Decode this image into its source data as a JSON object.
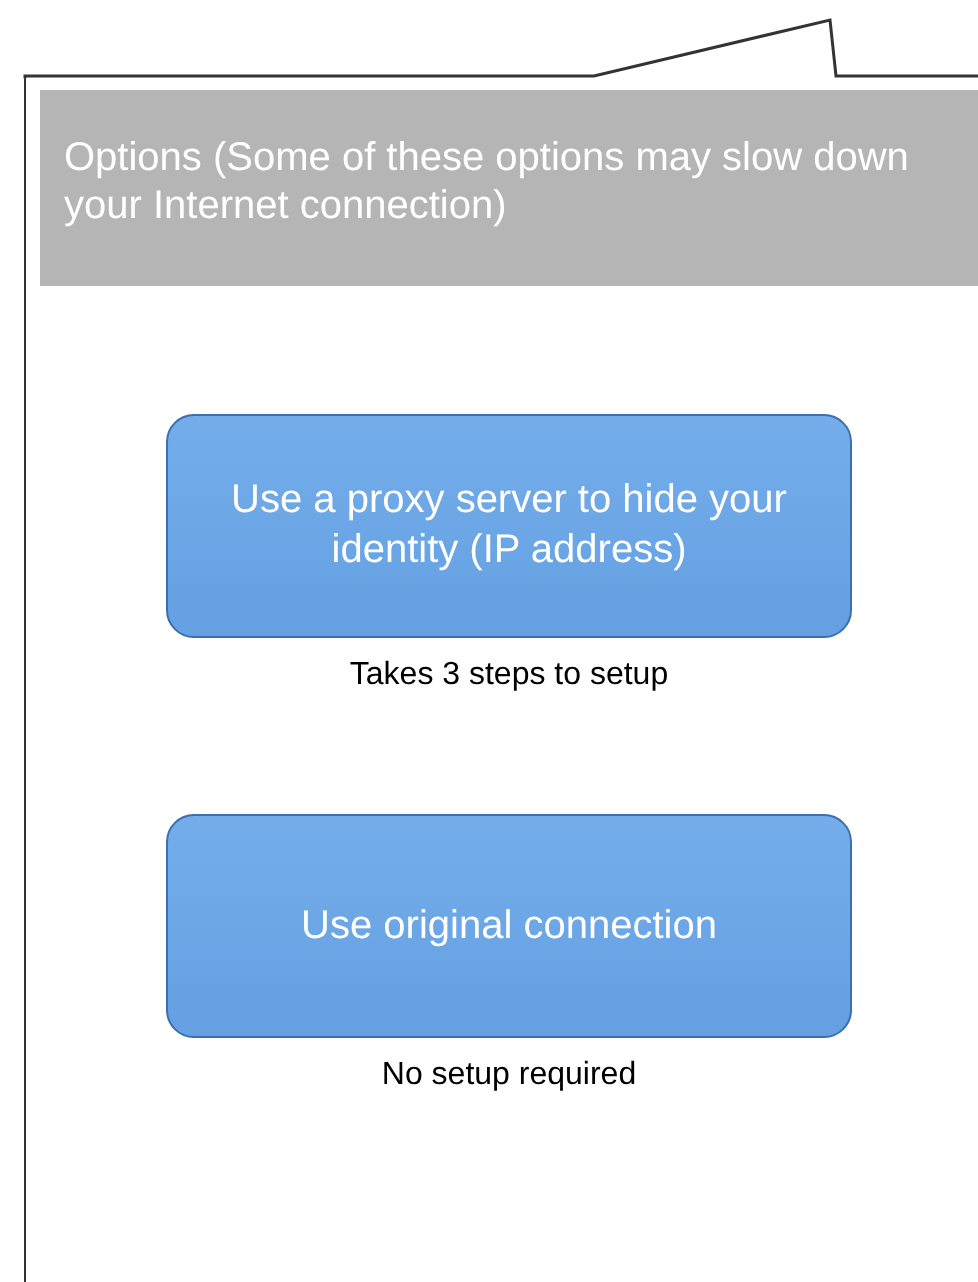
{
  "header": {
    "text": "Options (Some of these options may slow down your Internet connection)"
  },
  "options": [
    {
      "label": "Use a proxy server to hide your identity (IP address)",
      "note": "Takes 3 steps to setup"
    },
    {
      "label": "Use original connection",
      "note": "No setup required"
    }
  ]
}
